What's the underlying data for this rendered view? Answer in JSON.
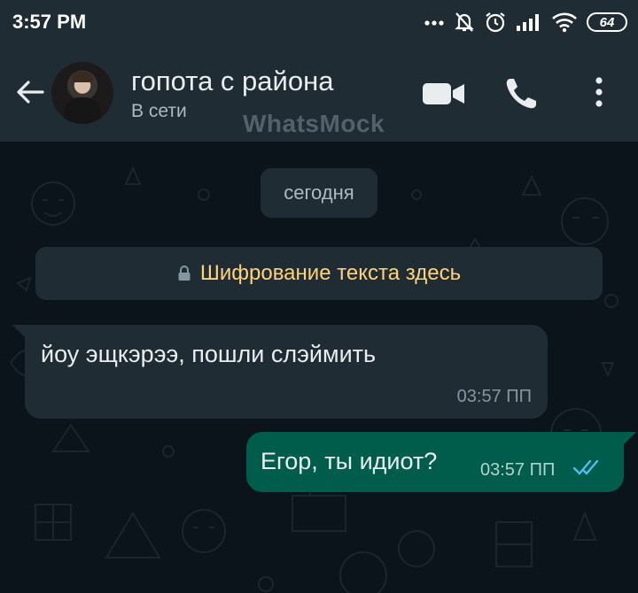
{
  "status_bar": {
    "time": "3:57 PM",
    "battery": "64",
    "icons": [
      "dots-icon",
      "bell-muted-icon",
      "alarm-icon",
      "signal-icon",
      "wifi-icon",
      "battery-icon"
    ]
  },
  "header": {
    "contact_name": "гопота с района",
    "contact_status": "В сети",
    "watermark": "WhatsMock",
    "actions": [
      "video-call-icon",
      "voice-call-icon",
      "more-vert-icon"
    ]
  },
  "chat": {
    "date_label": "сегодня",
    "encryption_notice": "Шифрование текста здесь",
    "messages": [
      {
        "direction": "incoming",
        "text": "йоу эщкэрээ, пошли слэймить",
        "time": "03:57 ПП"
      },
      {
        "direction": "outgoing",
        "text": "Егор, ты идиот?",
        "time": "03:57 ПП",
        "read": true
      }
    ]
  },
  "colors": {
    "header_bg": "#1f2c34",
    "chat_bg": "#0b141a",
    "incoming_bubble": "#1f2c34",
    "outgoing_bubble": "#005c4b",
    "encryption_text": "#ffd279",
    "read_ticks": "#53bdeb"
  }
}
